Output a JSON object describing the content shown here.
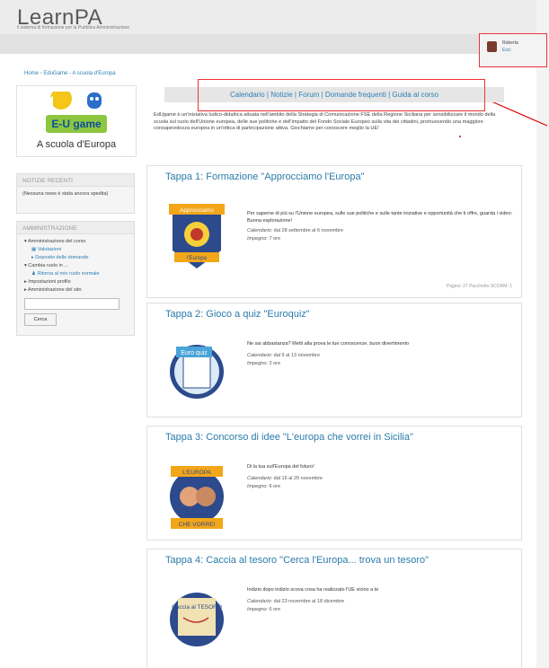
{
  "site": {
    "title": "LearnPA",
    "tagline": "Il sistema di formazione per la Pubblica Amministrazione"
  },
  "user": {
    "name": "Roberta",
    "logout": "Esci"
  },
  "breadcrumb": {
    "home": "Home",
    "current": "EduGame - A scuola d'Europa"
  },
  "course_logo": {
    "text": "A scuola d'Europa",
    "brand": "E-U game"
  },
  "news": {
    "heading": "NOTIZIE RECENTI",
    "empty": "(Nessuna news è stata ancora spedita)"
  },
  "admin": {
    "heading": "AMMINISTRAZIONE",
    "course_admin": "Amministrazione del corso",
    "valutazioni": "Valutazioni",
    "deposito": "Deposito delle domande",
    "cambia_ruolo": "Cambia ruolo in ...",
    "ritorna": "Ritorna al mio ruolo normale",
    "impostazioni": "Impostazioni profilo",
    "sito": "Amministrazione del sito",
    "search_button": "Cerca"
  },
  "nav": {
    "links": [
      "Calendario",
      "Notizie",
      "Forum",
      "Domande frequenti",
      "Guida al corso"
    ]
  },
  "intro": "EdUgame è un'iniziativa ludico-didattica attuata nell'ambito della Strategia di Comunicazione FSE della Regione Siciliana per sensibilizzare il mondo della scuola sul ruolo dell'Unione europea, delle sue politiche e dell'impatto del Fondo Sociale Europeo sulla vita dei cittadini, promuovendo una maggiore consapevolezza europea in un'ottica di partecipazione attiva. Giochiamo per conoscere meglio la UE!",
  "labels": {
    "calendario": "Calendario:",
    "impegno": "Impegno:"
  },
  "tappe": [
    {
      "title": "Tappa 1: Formazione \"Approcciamo l'Europa\"",
      "desc": "Per saperne di più su l'Unione europea, sulle sue politiche e sulle tante iniziative e opportunità che ti offre, guarda i video: Buona esplorazione!",
      "calendario": "dal 28 settembre al 6 novembre",
      "impegno": "7 ore",
      "footer": "Pagine: 27  Pacchetto SCORM: 1",
      "badge_top": "Approcciamo",
      "badge_bottom": "l'Europa"
    },
    {
      "title": "Tappa 2: Gioco a quiz \"Euroquiz\"",
      "desc": "Ne sai abbastanza? Metti alla prova le tue conoscenze, buon divertimento",
      "calendario": "dal 9 al 13 novembre",
      "impegno": "2 ore",
      "badge_top": "Euro quiz"
    },
    {
      "title": "Tappa 3: Concorso di idee \"L'europa che vorrei in Sicilia\"",
      "desc": "Di la tua sull'Europa del futuro!",
      "calendario": "dal 16 al 20 novembre",
      "impegno": "6 ore",
      "badge_top": "L'EUROPA",
      "badge_bottom": "CHE VORREI"
    },
    {
      "title": "Tappa 4: Caccia al tesoro \"Cerca l'Europa... trova un tesoro\"",
      "desc": "Indizio dopo indizio scova cosa ha realizzato l'UE vicino a te",
      "calendario": "dal 23 novembre al 18 dicembre",
      "impegno": "6 ore",
      "badge_top": "Caccia al TESORO"
    }
  ]
}
